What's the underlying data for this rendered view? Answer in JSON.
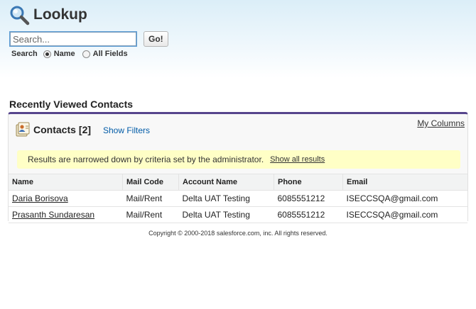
{
  "header": {
    "title": "Lookup",
    "icon": "magnifier-icon"
  },
  "search": {
    "placeholder": "Search...",
    "value": "",
    "go_label": "Go!",
    "scope_label": "Search",
    "options": [
      {
        "label": "Name",
        "checked": true
      },
      {
        "label": "All Fields",
        "checked": false
      }
    ]
  },
  "section": {
    "title": "Recently Viewed Contacts"
  },
  "panel": {
    "icon": "contacts-icon",
    "title": "Contacts",
    "count": "[2]",
    "show_filters": "Show Filters",
    "my_columns": "My Columns",
    "accent_color": "#56458c",
    "notice": {
      "text": "Results are narrowed down by criteria set by the administrator.",
      "link": "Show all results"
    }
  },
  "table": {
    "columns": [
      "Name",
      "Mail Code",
      "Account Name",
      "Phone",
      "Email"
    ],
    "rows": [
      {
        "name": "Daria Borisova",
        "mail_code": "Mail/Rent",
        "account": "Delta UAT Testing",
        "phone": "6085551212",
        "email": "ISECCSQA@gmail.com"
      },
      {
        "name": "Prasanth Sundaresan",
        "mail_code": "Mail/Rent",
        "account": "Delta UAT Testing",
        "phone": "6085551212",
        "email": "ISECCSQA@gmail.com"
      }
    ]
  },
  "footer": {
    "copyright": "Copyright © 2000-2018 salesforce.com, inc. All rights reserved."
  }
}
